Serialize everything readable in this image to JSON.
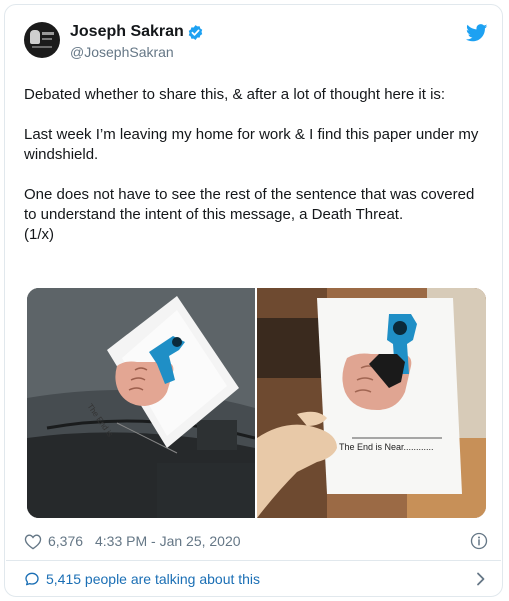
{
  "user": {
    "display_name": "Joseph Sakran",
    "handle": "@JosephSakran",
    "avatar_icon": "avatar-image",
    "verified_color": "#1da1f2"
  },
  "tweet": {
    "paragraphs": [
      "Debated whether to share this, & after a lot of thought here it is:",
      "Last week I’m leaving my home for work & I find this paper under my windshield.",
      "One does not have to see the rest of the sentence that was covered to understand the intent of this message, a Death Threat.",
      "(1/x)"
    ]
  },
  "media": {
    "photos": [
      {
        "caption_text": "The End is"
      },
      {
        "caption_text": "The End is Near............"
      }
    ]
  },
  "stats": {
    "likes": "6,376",
    "timestamp": "4:33 PM - Jan 25, 2020"
  },
  "footer": {
    "talking": "5,415 people are talking about this"
  },
  "colors": {
    "brand": "#1da1f2",
    "link": "#1b6fb5",
    "muted": "#657786"
  }
}
